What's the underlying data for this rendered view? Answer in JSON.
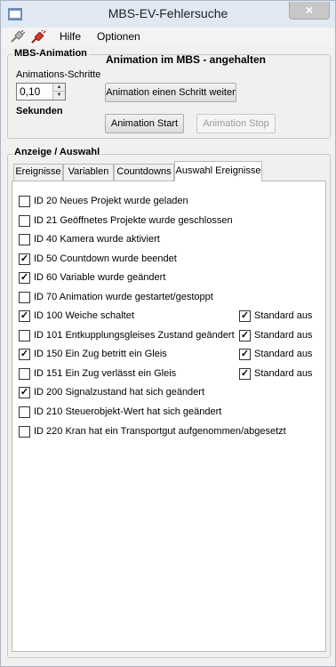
{
  "window": {
    "title": "MBS-EV-Fehlersuche",
    "close_glyph": "×"
  },
  "menu": {
    "items": [
      "Hilfe",
      "Optionen"
    ],
    "icons": [
      "plug-icon",
      "plug-connected-icon"
    ]
  },
  "animation": {
    "group_title": "MBS-Animation",
    "schritte_label": "Animations-Schritte",
    "schritte_value": "0,10",
    "seconds_label": "Sekunden",
    "status": "Animation im MBS - angehalten",
    "step_button": "Animation einen Schritt weiter",
    "start_button": "Animation Start",
    "stop_button": "Animation Stop"
  },
  "display": {
    "group_title": "Anzeige / Auswahl",
    "tabs": [
      "Ereignisse",
      "Variablen",
      "Countdowns",
      "Auswahl Ereignisse"
    ],
    "active_tab": "Auswahl Ereignisse",
    "events": [
      {
        "label": "ID  20 Neues Projekt wurde geladen",
        "checked": false
      },
      {
        "label": "ID  21 Geöffnetes Projekte wurde geschlossen",
        "checked": false
      },
      {
        "label": "ID  40 Kamera wurde aktiviert",
        "checked": false
      },
      {
        "label": "ID  50 Countdown wurde beendet",
        "checked": true
      },
      {
        "label": "ID  60 Variable wurde geändert",
        "checked": true
      },
      {
        "label": "ID  70 Animation wurde gestartet/gestoppt",
        "checked": false
      },
      {
        "label": "ID 100 Weiche schaltet",
        "checked": true,
        "standard_checked": true
      },
      {
        "label": "ID 101 Entkupplungsgleises Zustand geändert",
        "checked": false,
        "standard_checked": true
      },
      {
        "label": "ID 150 Ein Zug betritt ein Gleis",
        "checked": true,
        "standard_checked": true
      },
      {
        "label": "ID 151 Ein Zug verlässt ein Gleis",
        "checked": false,
        "standard_checked": true
      },
      {
        "label": "ID 200 Signalzustand hat sich geändert",
        "checked": true
      },
      {
        "label": "ID 210 Steuerobjekt-Wert hat sich geändert",
        "checked": false
      },
      {
        "label": "ID 220 Kran hat ein Transportgut aufgenommen/abgesetzt",
        "checked": false
      }
    ],
    "standard_label": "Standard aus",
    "check_glyph": "✓"
  },
  "colors": {
    "titlebar": "#dfe8f3",
    "window_bg": "#f0f0f0",
    "panel_bg": "#ffffff",
    "close_button": "#c7c7c7"
  }
}
